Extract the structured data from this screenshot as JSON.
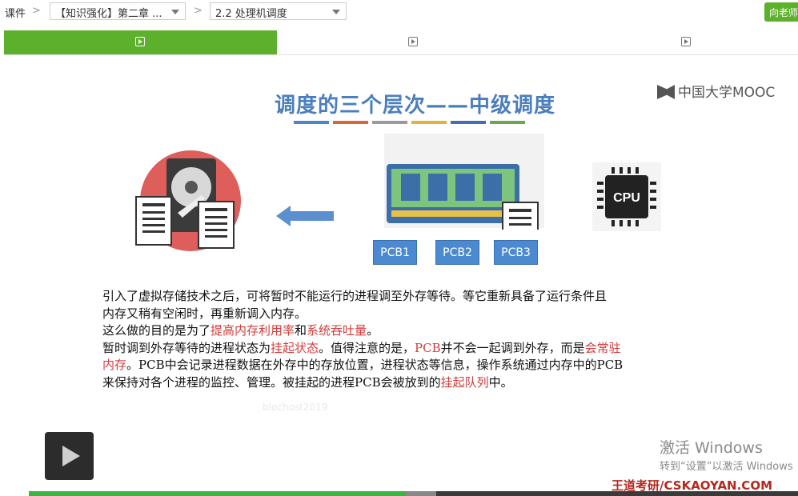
{
  "breadcrumb": {
    "root": "课件",
    "chapter_select": "【知识强化】第二章 ...",
    "section_select": "2.2 处理机调度"
  },
  "header": {
    "ask_teacher_label": "向老师"
  },
  "tabs": [
    {
      "icon": "video-icon",
      "active": true
    },
    {
      "icon": "video-icon",
      "active": false
    },
    {
      "icon": "video-icon",
      "active": false
    }
  ],
  "slide": {
    "title": "调度的三个层次——中级调度",
    "logo_text": "中国大学MOOC",
    "colors": [
      "#4a86c8",
      "#d9663a",
      "#9a9a9a",
      "#e5b13a",
      "#3f6fb5",
      "#6aa84f"
    ],
    "pcb_labels": [
      "PCB1",
      "PCB2",
      "PCB3"
    ],
    "cpu_label": "CPU",
    "paragraph": [
      [
        {
          "t": "引入了虚拟存储技术之后，可将暂时不能运行的进程调至外存等待。等它重新具备了运行条件且"
        }
      ],
      [
        {
          "t": "内存又稍有空闲时，再重新调入内存。"
        }
      ],
      [
        {
          "t": "这么做的目的是为了"
        },
        {
          "t": "提高内存利用率",
          "hl": true
        },
        {
          "t": "和"
        },
        {
          "t": "系统吞吐量",
          "hl": true
        },
        {
          "t": "。"
        }
      ],
      [
        {
          "t": "暂时调到外存等待的进程状态为"
        },
        {
          "t": "挂起状态",
          "hl": true
        },
        {
          "t": "。值得注意的是，"
        },
        {
          "t": "PCB",
          "hl": true
        },
        {
          "t": "并不会一起调到外存，而是"
        },
        {
          "t": "会常驻",
          "hl": true
        }
      ],
      [
        {
          "t": "内存",
          "hl": true
        },
        {
          "t": "。PCB中会记录进程数据在外存中的存放位置，进程状态等信息，操作系统通过内存中的PCB"
        }
      ],
      [
        {
          "t": "来保持对各个进程的监控、管理。被挂起的进程PCB会被放到的"
        },
        {
          "t": "挂起队列",
          "hl": true
        },
        {
          "t": "中。"
        }
      ]
    ],
    "watermark": "blochost2019"
  },
  "player": {
    "progress_fraction": 0.49,
    "buffered_fraction": 0.53
  },
  "overlay": {
    "activate_line1": "激活 Windows",
    "activate_line2": "转到“设置”以激活 Windows",
    "brand": "王道考研/CSKAOYAN.COM"
  }
}
